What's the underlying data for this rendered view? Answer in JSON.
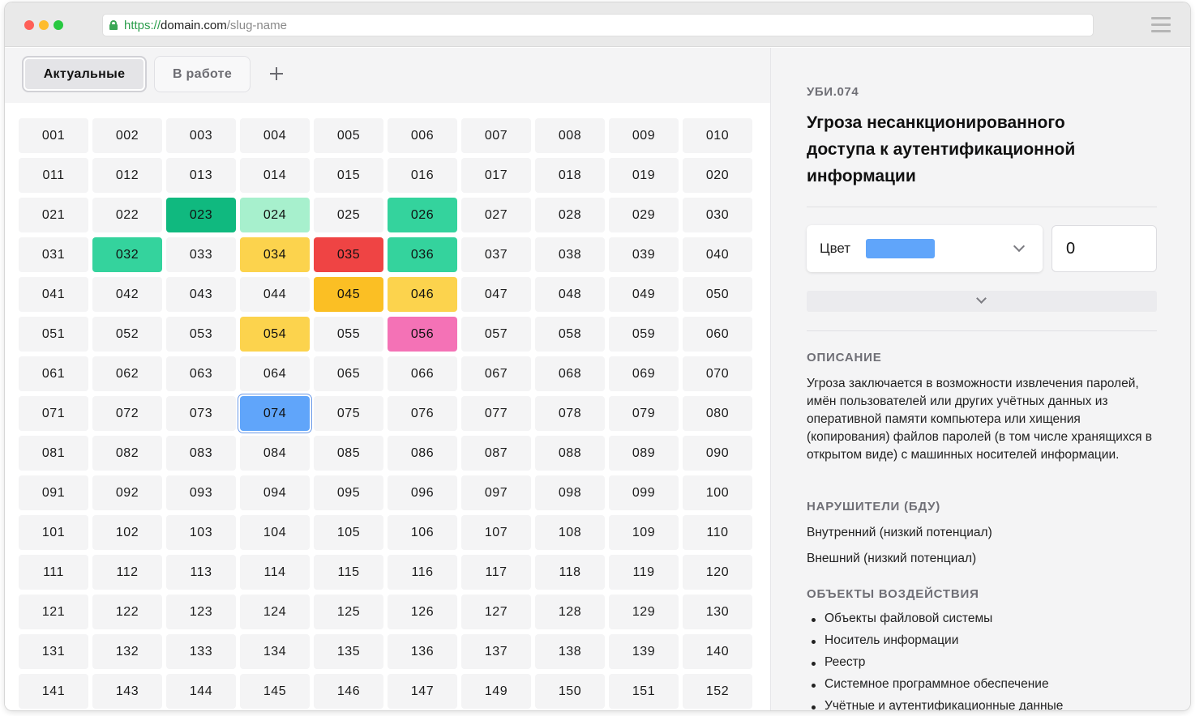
{
  "browser": {
    "url_scheme": "https://",
    "url_host": "domain.com",
    "url_path": "/slug-name"
  },
  "tabs": [
    {
      "label": "Актуальные",
      "active": true
    },
    {
      "label": "В работе",
      "active": false
    }
  ],
  "grid": {
    "cells": [
      {
        "label": "001"
      },
      {
        "label": "002"
      },
      {
        "label": "003"
      },
      {
        "label": "004"
      },
      {
        "label": "005"
      },
      {
        "label": "006"
      },
      {
        "label": "007"
      },
      {
        "label": "008"
      },
      {
        "label": "009"
      },
      {
        "label": "010"
      },
      {
        "label": "011"
      },
      {
        "label": "012"
      },
      {
        "label": "013"
      },
      {
        "label": "014"
      },
      {
        "label": "015"
      },
      {
        "label": "016"
      },
      {
        "label": "017"
      },
      {
        "label": "018"
      },
      {
        "label": "019"
      },
      {
        "label": "020"
      },
      {
        "label": "021"
      },
      {
        "label": "022"
      },
      {
        "label": "023",
        "bg": "#10b97f",
        "fg": "#111111"
      },
      {
        "label": "024",
        "bg": "#a7f0cd",
        "fg": "#111111"
      },
      {
        "label": "025"
      },
      {
        "label": "026",
        "bg": "#34d39d",
        "fg": "#111111"
      },
      {
        "label": "027"
      },
      {
        "label": "028"
      },
      {
        "label": "029"
      },
      {
        "label": "030"
      },
      {
        "label": "031"
      },
      {
        "label": "032",
        "bg": "#34d39d",
        "fg": "#111111"
      },
      {
        "label": "033"
      },
      {
        "label": "034",
        "bg": "#fcd34d",
        "fg": "#111111"
      },
      {
        "label": "035",
        "bg": "#ef4444",
        "fg": "#111111"
      },
      {
        "label": "036",
        "bg": "#34d39d",
        "fg": "#111111"
      },
      {
        "label": "037"
      },
      {
        "label": "038"
      },
      {
        "label": "039"
      },
      {
        "label": "040"
      },
      {
        "label": "041"
      },
      {
        "label": "042"
      },
      {
        "label": "043"
      },
      {
        "label": "044"
      },
      {
        "label": "045",
        "bg": "#fbbf24",
        "fg": "#111111"
      },
      {
        "label": "046",
        "bg": "#fcd34d",
        "fg": "#111111"
      },
      {
        "label": "047"
      },
      {
        "label": "048"
      },
      {
        "label": "049"
      },
      {
        "label": "050"
      },
      {
        "label": "051"
      },
      {
        "label": "052"
      },
      {
        "label": "053"
      },
      {
        "label": "054",
        "bg": "#fcd34d",
        "fg": "#111111"
      },
      {
        "label": "055"
      },
      {
        "label": "056",
        "bg": "#f472b6",
        "fg": "#111111"
      },
      {
        "label": "057"
      },
      {
        "label": "058"
      },
      {
        "label": "059"
      },
      {
        "label": "060"
      },
      {
        "label": "061"
      },
      {
        "label": "062"
      },
      {
        "label": "063"
      },
      {
        "label": "064"
      },
      {
        "label": "065"
      },
      {
        "label": "066"
      },
      {
        "label": "067"
      },
      {
        "label": "068"
      },
      {
        "label": "069"
      },
      {
        "label": "070"
      },
      {
        "label": "071"
      },
      {
        "label": "072"
      },
      {
        "label": "073"
      },
      {
        "label": "074",
        "bg": "#60a5fa",
        "fg": "#111111",
        "selected": true
      },
      {
        "label": "075"
      },
      {
        "label": "076"
      },
      {
        "label": "077"
      },
      {
        "label": "078"
      },
      {
        "label": "079"
      },
      {
        "label": "080"
      },
      {
        "label": "081"
      },
      {
        "label": "082"
      },
      {
        "label": "083"
      },
      {
        "label": "084"
      },
      {
        "label": "085"
      },
      {
        "label": "086"
      },
      {
        "label": "087"
      },
      {
        "label": "088"
      },
      {
        "label": "089"
      },
      {
        "label": "090"
      },
      {
        "label": "091"
      },
      {
        "label": "092"
      },
      {
        "label": "093"
      },
      {
        "label": "094"
      },
      {
        "label": "095"
      },
      {
        "label": "096"
      },
      {
        "label": "097"
      },
      {
        "label": "098"
      },
      {
        "label": "099"
      },
      {
        "label": "100"
      },
      {
        "label": "101"
      },
      {
        "label": "102"
      },
      {
        "label": "103"
      },
      {
        "label": "104"
      },
      {
        "label": "105"
      },
      {
        "label": "106"
      },
      {
        "label": "107"
      },
      {
        "label": "108"
      },
      {
        "label": "109"
      },
      {
        "label": "110"
      },
      {
        "label": "111"
      },
      {
        "label": "112"
      },
      {
        "label": "113"
      },
      {
        "label": "114"
      },
      {
        "label": "115"
      },
      {
        "label": "116"
      },
      {
        "label": "117"
      },
      {
        "label": "118"
      },
      {
        "label": "119"
      },
      {
        "label": "120"
      },
      {
        "label": "121"
      },
      {
        "label": "122"
      },
      {
        "label": "123"
      },
      {
        "label": "124"
      },
      {
        "label": "125"
      },
      {
        "label": "126"
      },
      {
        "label": "127"
      },
      {
        "label": "128"
      },
      {
        "label": "129"
      },
      {
        "label": "130"
      },
      {
        "label": "131"
      },
      {
        "label": "132"
      },
      {
        "label": "133"
      },
      {
        "label": "134"
      },
      {
        "label": "135"
      },
      {
        "label": "136"
      },
      {
        "label": "137"
      },
      {
        "label": "138"
      },
      {
        "label": "139"
      },
      {
        "label": "140"
      },
      {
        "label": "141"
      },
      {
        "label": "143"
      },
      {
        "label": "144"
      },
      {
        "label": "145"
      },
      {
        "label": "146"
      },
      {
        "label": "147"
      },
      {
        "label": "149"
      },
      {
        "label": "150"
      },
      {
        "label": "151"
      },
      {
        "label": "152"
      }
    ]
  },
  "detail": {
    "id": "УБИ.074",
    "title": "Угроза несанкционированного доступа к аутентификационной информации",
    "color_label": "Цвет",
    "color_value": "#60a5fa",
    "number_value": "0",
    "description_heading": "ОПИСАНИЕ",
    "description": "Угроза заключается в возможности извлечения паролей, имён пользователей или других учётных данных из оперативной памяти компьютера или хищения (копирования) файлов паролей (в том числе хранящихся в открытом виде) с машинных носителей информации.",
    "violators_heading": "НАРУШИТЕЛИ (БДУ)",
    "violators": [
      "Внутренний (низкий потенциал)",
      "Внешний (низкий потенциал)"
    ],
    "objects_heading": "ОБЪЕКТЫ ВОЗДЕЙСТВИЯ",
    "objects": [
      "Объекты файловой системы",
      "Носитель информации",
      "Реестр",
      "Системное программное обеспечение",
      "Учётные и аутентификационные данные"
    ]
  }
}
